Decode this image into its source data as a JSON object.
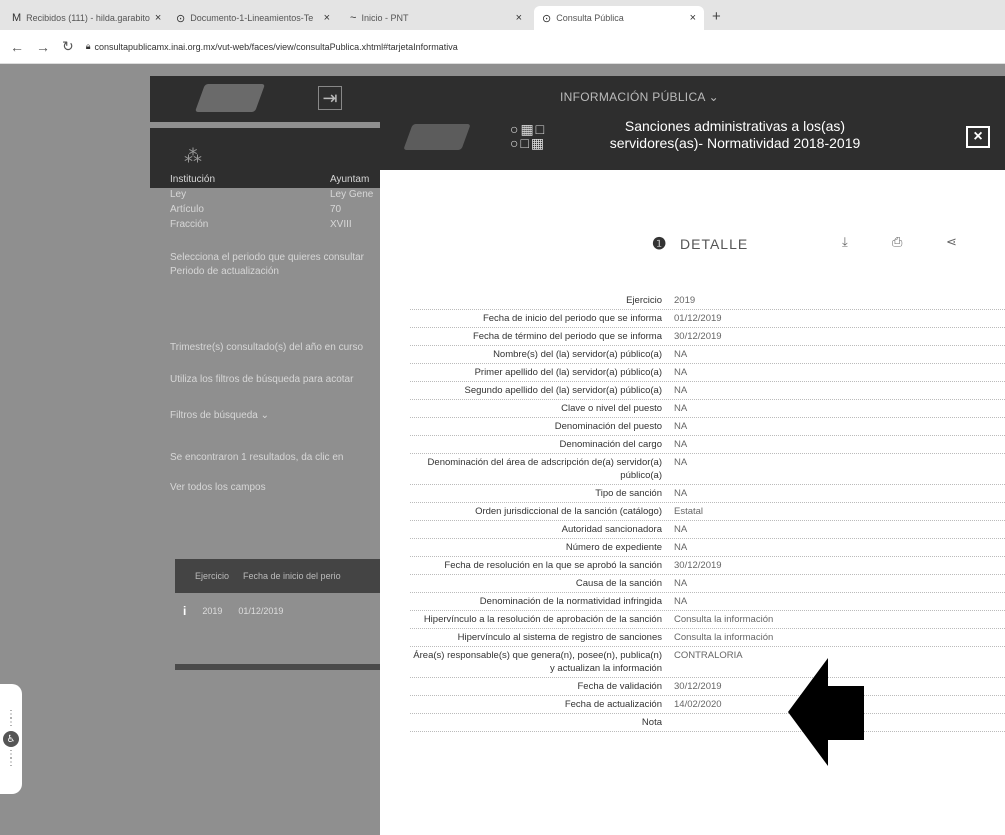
{
  "browser": {
    "tabs": [
      {
        "icon": "M",
        "title": "Recibidos (111) - hilda.garabito",
        "close": "×"
      },
      {
        "icon": "⊙",
        "title": "Documento-1-Lineamientos-Te",
        "close": "×"
      },
      {
        "icon": "~",
        "title": "Inicio - PNT",
        "close": "×"
      },
      {
        "icon": "⊙",
        "title": "Consulta Pública",
        "close": "×"
      }
    ],
    "new_tab": "+",
    "url": "consultapublicamx.inai.org.mx/vut-web/faces/view/consultaPublica.xhtml#tarjetaInformativa"
  },
  "page": {
    "menu_label": "INFORMACIÓN PÚBLICA ⌄",
    "left_fields": [
      {
        "label": "Institución",
        "value": "Ayuntam"
      },
      {
        "label": "Ley",
        "value": "Ley Gene"
      },
      {
        "label": "Artículo",
        "value": "70"
      },
      {
        "label": "Fracción",
        "value": "XVIII"
      }
    ],
    "period_prompt": "Selecciona el periodo que quieres consultar",
    "period_label": "Periodo de actualización",
    "quarter_text": "Trimestre(s) consultado(s) del año en curso",
    "filters_hint": "Utiliza los filtros de búsqueda para acotar",
    "filters_label": "Filtros de búsqueda ⌄",
    "results_text": "Se encontraron 1 resultados, da clic en",
    "view_all": "Ver todos los campos",
    "table_headers": [
      "Ejercicio",
      "Fecha de inicio del perio"
    ],
    "table_row": {
      "icon": "i",
      "year": "2019",
      "date": "01/12/2019"
    }
  },
  "modal": {
    "title": "Sanciones administrativas a los(as) servidores(as)- Normatividad 2018-2019",
    "close_label": "[×]",
    "detail_label": "DETALLE",
    "rows": [
      {
        "k": "Ejercicio",
        "v": "2019"
      },
      {
        "k": "Fecha de inicio del periodo que se informa",
        "v": "01/12/2019"
      },
      {
        "k": "Fecha de término del periodo que se informa",
        "v": "30/12/2019"
      },
      {
        "k": "Nombre(s) del (la) servidor(a) público(a)",
        "v": "NA"
      },
      {
        "k": "Primer apellido del (la) servidor(a) público(a)",
        "v": "NA"
      },
      {
        "k": "Segundo apellido del (la) servidor(a) público(a)",
        "v": "NA"
      },
      {
        "k": "Clave o nivel del puesto",
        "v": "NA"
      },
      {
        "k": "Denominación del puesto",
        "v": "NA"
      },
      {
        "k": "Denominación del cargo",
        "v": "NA"
      },
      {
        "k": "Denominación del área de adscripción de(a) servidor(a) público(a)",
        "v": "NA"
      },
      {
        "k": "Tipo de sanción",
        "v": "NA"
      },
      {
        "k": "Orden jurisdiccional de la sanción (catálogo)",
        "v": "Estatal"
      },
      {
        "k": "Autoridad sancionadora",
        "v": "NA"
      },
      {
        "k": "Número de expediente",
        "v": "NA"
      },
      {
        "k": "Fecha de resolución en la que se aprobó la sanción",
        "v": "30/12/2019"
      },
      {
        "k": "Causa de la sanción",
        "v": "NA"
      },
      {
        "k": "Denominación de la normatividad infringida",
        "v": "NA"
      },
      {
        "k": "Hipervínculo a la resolución de aprobación de la sanción",
        "v": "Consulta la información"
      },
      {
        "k": "Hipervínculo al sistema de registro de sanciones",
        "v": "Consulta la información"
      },
      {
        "k": "Área(s) responsable(s) que genera(n), posee(n), publica(n) y actualizan la información",
        "v": "CONTRALORIA"
      },
      {
        "k": "Fecha de validación",
        "v": "30/12/2019"
      },
      {
        "k": "Fecha de actualización",
        "v": "14/02/2020"
      },
      {
        "k": "Nota",
        "v": ""
      }
    ]
  },
  "colors": {
    "header_dark": "#2e2e2e",
    "overlay_gray": "#8f8f8f"
  }
}
